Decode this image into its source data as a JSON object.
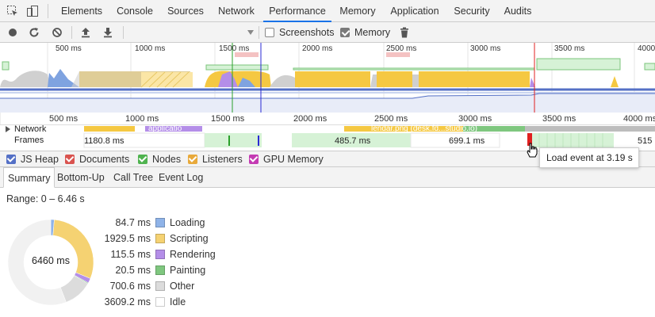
{
  "top_tabs": [
    "Elements",
    "Console",
    "Sources",
    "Network",
    "Performance",
    "Memory",
    "Application",
    "Security",
    "Audits"
  ],
  "active_tab": "Performance",
  "toolbar": {
    "screenshots_label": "Screenshots",
    "screenshots_checked": false,
    "memory_label": "Memory",
    "memory_checked": true
  },
  "overview_ruler": [
    "500 ms",
    "1000 ms",
    "1500 ms",
    "2000 ms",
    "2500 ms",
    "3000 ms",
    "3500 ms",
    "4000"
  ],
  "timeline_ruler": [
    "500 ms",
    "1000 ms",
    "1500 ms",
    "2000 ms",
    "2500 ms",
    "3000 ms",
    "3500 ms",
    "4000 ms"
  ],
  "tracks": {
    "network_label": "Network",
    "network_items": [
      "applicatio",
      "lendar.png (desk.fd...studio.io)"
    ],
    "frames_label": "Frames",
    "frame_times": [
      "1180.8 ms",
      "485.7 ms",
      "699.1 ms",
      "515"
    ]
  },
  "counters": [
    {
      "label": "JS Heap",
      "color": "#5470c6",
      "checked": true
    },
    {
      "label": "Documents",
      "color": "#d9534f",
      "checked": true
    },
    {
      "label": "Nodes",
      "color": "#4fb34f",
      "checked": true
    },
    {
      "label": "Listeners",
      "color": "#e8a93a",
      "checked": true
    },
    {
      "label": "GPU Memory",
      "color": "#c43bb3",
      "checked": true
    }
  ],
  "bottom_tabs": [
    "Summary",
    "Bottom-Up",
    "Call Tree",
    "Event Log"
  ],
  "active_bottom_tab": "Summary",
  "summary": {
    "range": "Range: 0 – 6.46 s",
    "total": "6460 ms",
    "items": [
      {
        "value": "84.7 ms",
        "label": "Loading",
        "color": "#8fb3e8",
        "ms": 84.7
      },
      {
        "value": "1929.5 ms",
        "label": "Scripting",
        "color": "#f5d272",
        "ms": 1929.5
      },
      {
        "value": "115.5 ms",
        "label": "Rendering",
        "color": "#b48ee8",
        "ms": 115.5
      },
      {
        "value": "20.5 ms",
        "label": "Painting",
        "color": "#7fc77f",
        "ms": 20.5
      },
      {
        "value": "700.6 ms",
        "label": "Other",
        "color": "#dcdcdc",
        "ms": 700.6
      },
      {
        "value": "3609.2 ms",
        "label": "Idle",
        "color": "#ffffff",
        "ms": 3609.2
      }
    ]
  },
  "tooltip": "Load event at 3.19 s"
}
